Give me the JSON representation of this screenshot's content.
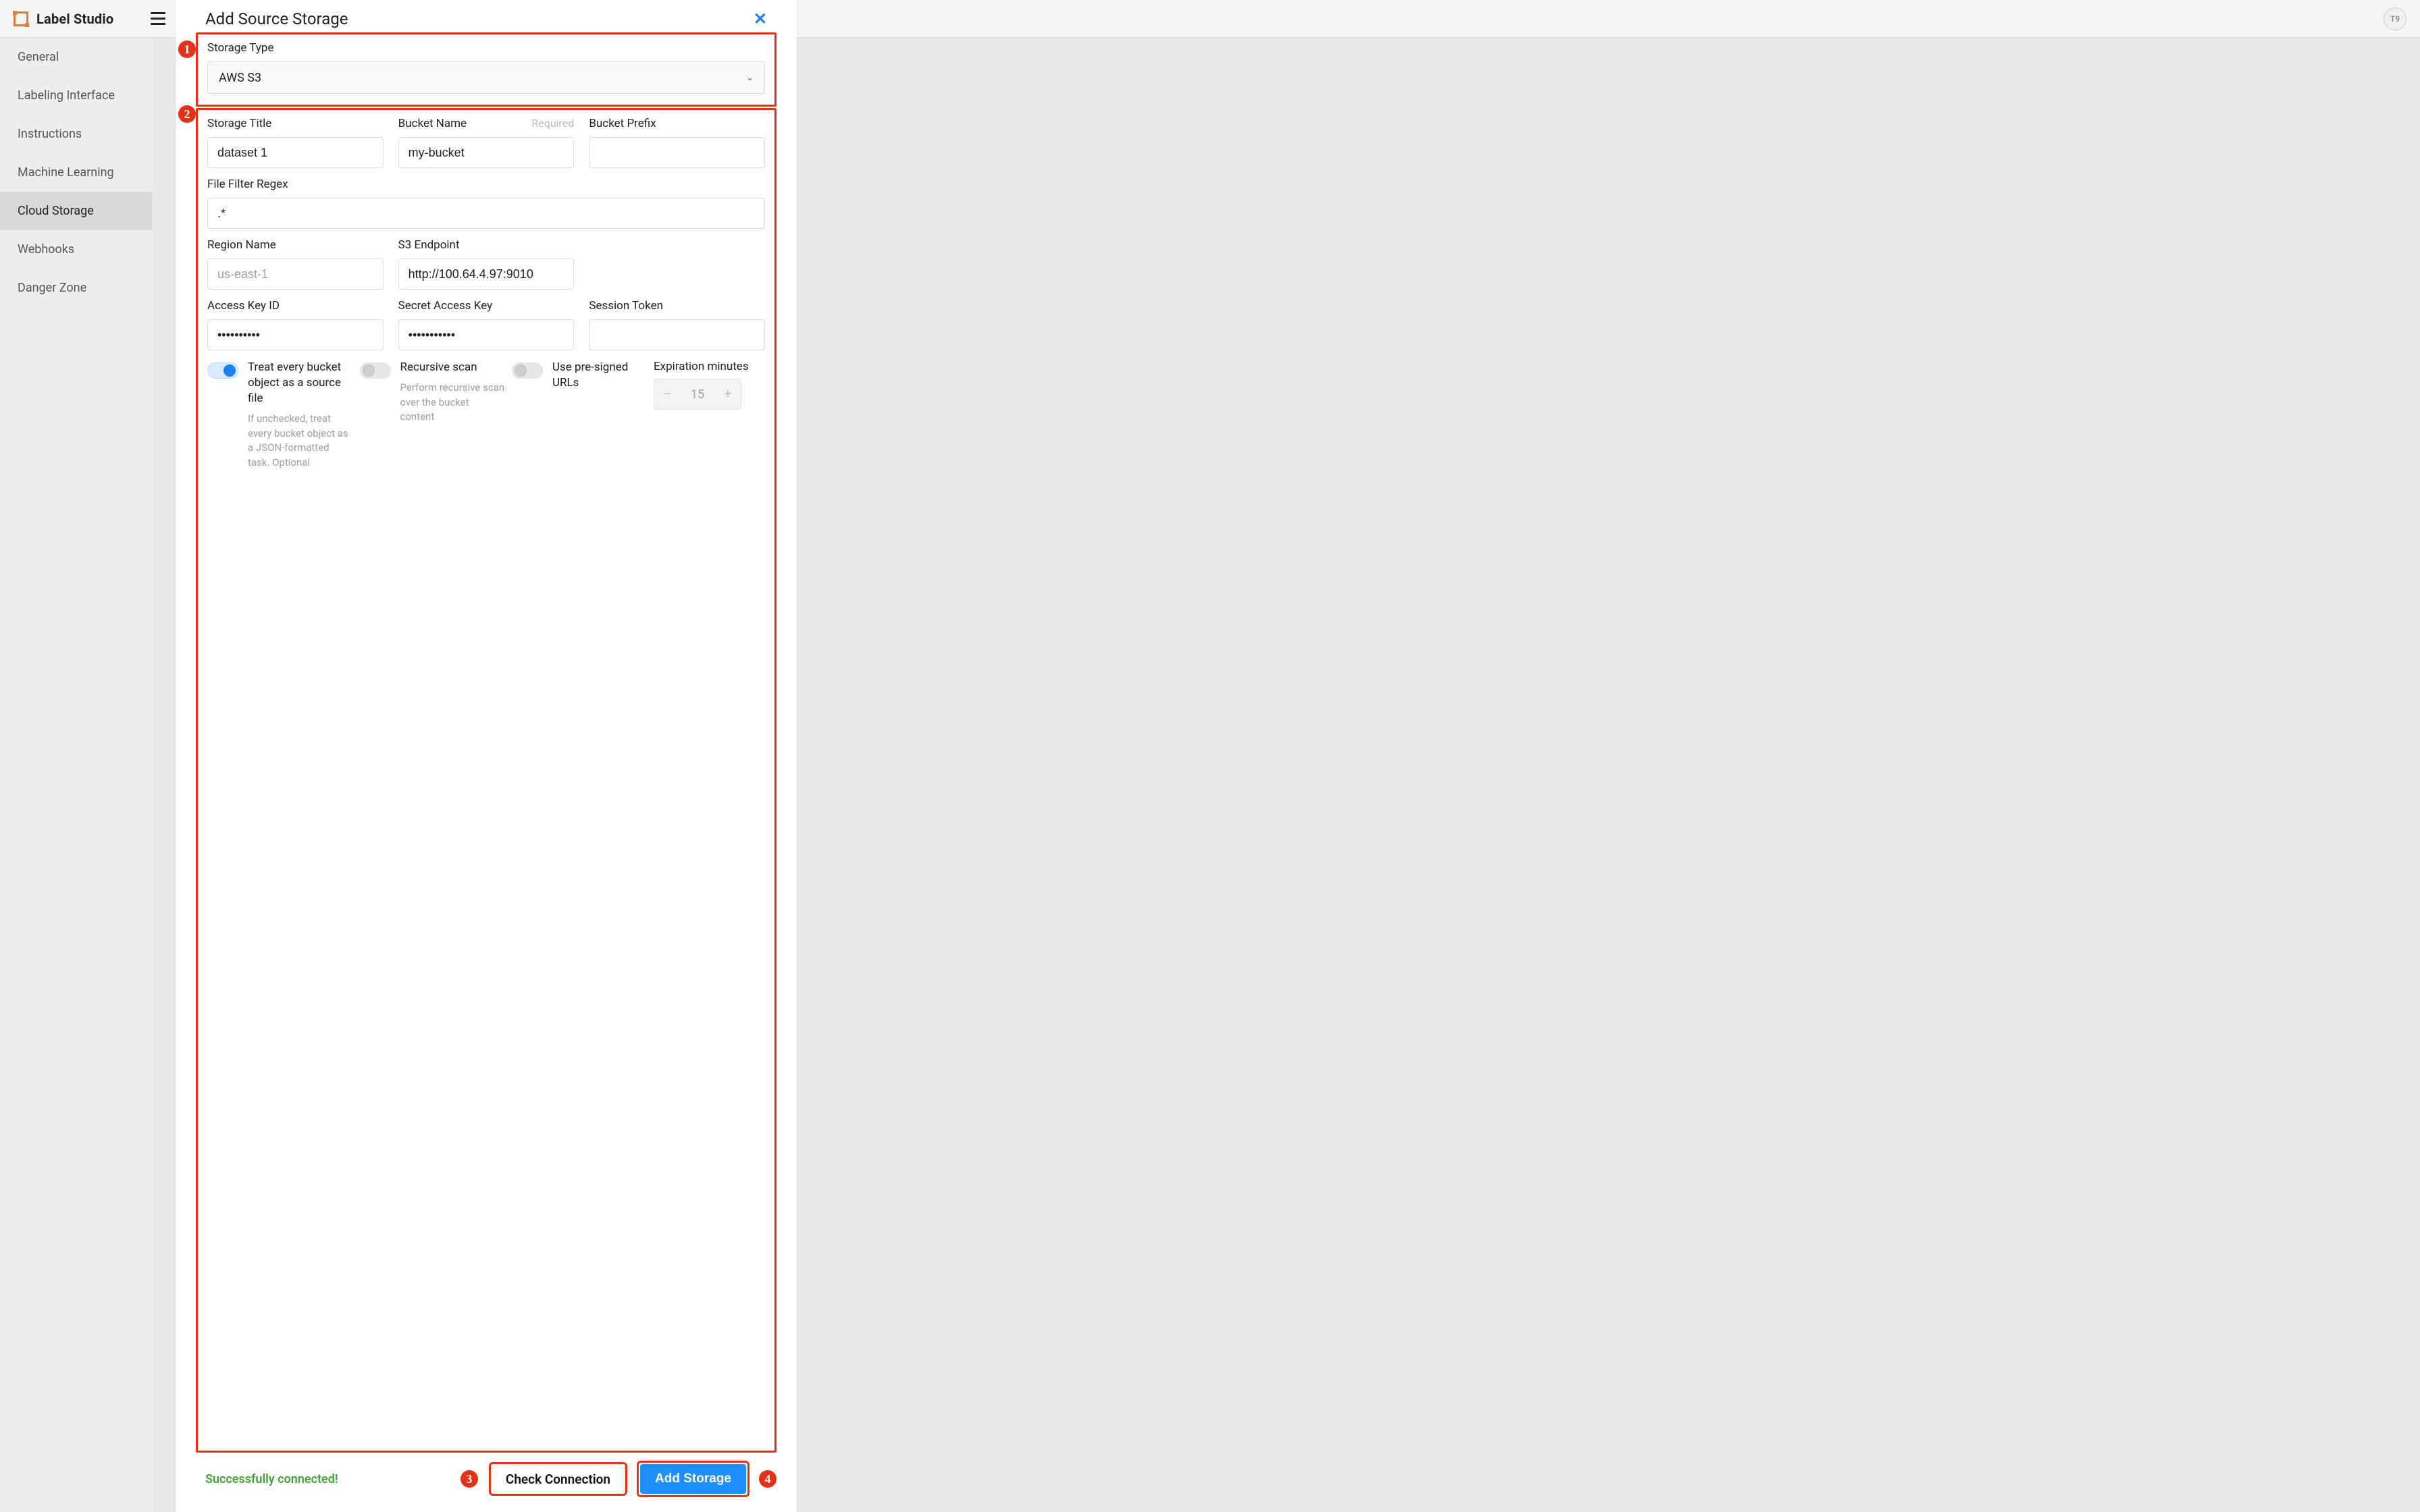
{
  "app": {
    "name": "Label Studio",
    "user_badge": "T9"
  },
  "sidebar": {
    "items": [
      {
        "label": "General",
        "active": false
      },
      {
        "label": "Labeling Interface",
        "active": false
      },
      {
        "label": "Instructions",
        "active": false
      },
      {
        "label": "Machine Learning",
        "active": false
      },
      {
        "label": "Cloud Storage",
        "active": true
      },
      {
        "label": "Webhooks",
        "active": false
      },
      {
        "label": "Danger Zone",
        "active": false
      }
    ]
  },
  "modal": {
    "title": "Add Source Storage",
    "storage_type": {
      "label": "Storage Type",
      "value": "AWS S3"
    },
    "fields": {
      "storage_title": {
        "label": "Storage Title",
        "value": "dataset 1"
      },
      "bucket_name": {
        "label": "Bucket Name",
        "required_tag": "Required",
        "value": "my-bucket"
      },
      "bucket_prefix": {
        "label": "Bucket Prefix",
        "value": ""
      },
      "file_filter": {
        "label": "File Filter Regex",
        "value": ".*"
      },
      "region": {
        "label": "Region Name",
        "placeholder": "us-east-1",
        "value": ""
      },
      "endpoint": {
        "label": "S3 Endpoint",
        "value": "http://100.64.4.97:9010"
      },
      "access_key": {
        "label": "Access Key ID",
        "value": "••••••••••"
      },
      "secret_key": {
        "label": "Secret Access Key",
        "value": "•••••••••••"
      },
      "session_token": {
        "label": "Session Token",
        "value": ""
      }
    },
    "toggles": {
      "treat_as_source": {
        "on": true,
        "label": "Treat every bucket object as a source file",
        "help": "If unchecked, treat every bucket object as a JSON-formatted task. Optional"
      },
      "recursive": {
        "on": false,
        "label": "Recursive scan",
        "help": "Perform recursive scan over the bucket content"
      },
      "presigned": {
        "on": false,
        "label": "Use pre-signed URLs"
      },
      "expiration": {
        "label": "Expiration minutes",
        "value": "15"
      }
    },
    "footer": {
      "success": "Successfully connected!",
      "check": "Check Connection",
      "add": "Add Storage"
    },
    "callouts": {
      "c1": "1",
      "c2": "2",
      "c3": "3",
      "c4": "4"
    }
  }
}
